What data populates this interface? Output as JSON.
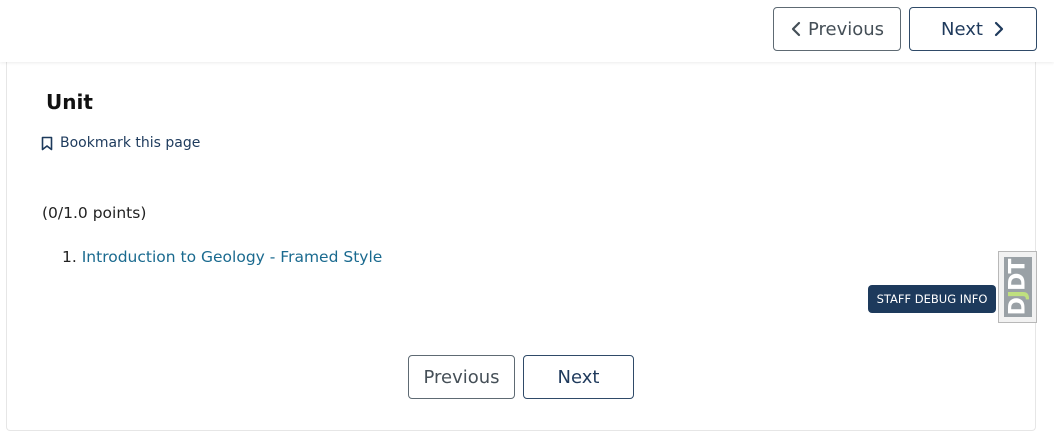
{
  "top_nav": {
    "previous_label": "Previous",
    "next_label": "Next"
  },
  "unit": {
    "title": "Unit",
    "bookmark_label": "Bookmark this page",
    "points": "(0/1.0 points)",
    "problems": [
      {
        "number": "1.",
        "title": "Introduction to Geology - Framed Style"
      }
    ]
  },
  "debug": {
    "staff_debug_label": "STAFF DEBUG INFO",
    "toolbar_handle": {
      "d1": "D",
      "j": "J",
      "dt": "DT"
    }
  },
  "bottom_nav": {
    "previous_label": "Previous",
    "next_label": "Next"
  },
  "colors": {
    "primary": "#1d3a5c",
    "link": "#1a6a8f",
    "border_gray": "#5e6a73"
  },
  "icons": {
    "previous": "chevron-left-icon",
    "next": "chevron-right-icon",
    "bookmark": "bookmark-icon"
  }
}
